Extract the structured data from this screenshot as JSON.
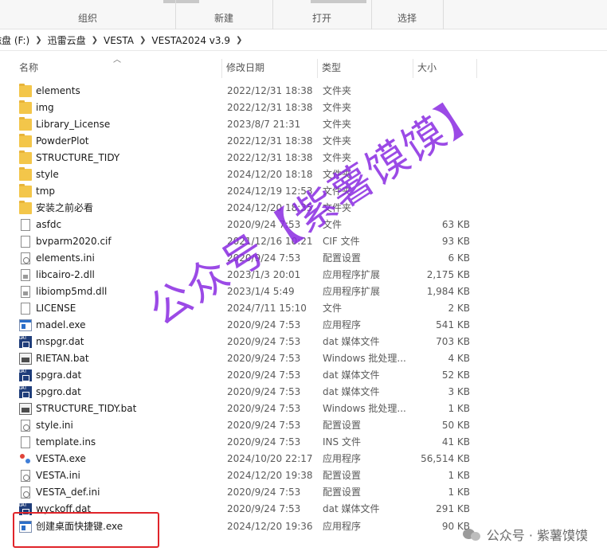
{
  "ribbon": {
    "groups": [
      {
        "label": "组织"
      },
      {
        "label": "新建"
      },
      {
        "label": "打开"
      },
      {
        "label": "选择"
      }
    ]
  },
  "breadcrumb": [
    "磁盘 (F:)",
    "迅雷云盘",
    "VESTA",
    "VESTA2024 v3.9"
  ],
  "columns": {
    "name": "名称",
    "date": "修改日期",
    "type": "类型",
    "size": "大小"
  },
  "files": [
    {
      "name": "elements",
      "date": "2022/12/31 18:38",
      "type": "文件夹",
      "size": "",
      "icon": "folder-icon"
    },
    {
      "name": "img",
      "date": "2022/12/31 18:38",
      "type": "文件夹",
      "size": "",
      "icon": "folder-icon"
    },
    {
      "name": "Library_License",
      "date": "2023/8/7 21:31",
      "type": "文件夹",
      "size": "",
      "icon": "folder-icon"
    },
    {
      "name": "PowderPlot",
      "date": "2022/12/31 18:38",
      "type": "文件夹",
      "size": "",
      "icon": "folder-icon"
    },
    {
      "name": "STRUCTURE_TIDY",
      "date": "2022/12/31 18:38",
      "type": "文件夹",
      "size": "",
      "icon": "folder-icon"
    },
    {
      "name": "style",
      "date": "2024/12/20 18:18",
      "type": "文件夹",
      "size": "",
      "icon": "folder-icon"
    },
    {
      "name": "tmp",
      "date": "2024/12/19 12:53",
      "type": "文件夹",
      "size": "",
      "icon": "folder-icon"
    },
    {
      "name": "安装之前必看",
      "date": "2024/12/20 18:35",
      "type": "文件夹",
      "size": "",
      "icon": "folder-icon"
    },
    {
      "name": "asfdc",
      "date": "2020/9/24 7:53",
      "type": "文件",
      "size": "63 KB",
      "icon": "file-icon"
    },
    {
      "name": "bvparm2020.cif",
      "date": "2021/12/16 10:21",
      "type": "CIF 文件",
      "size": "93 KB",
      "icon": "file-icon"
    },
    {
      "name": "elements.ini",
      "date": "2020/9/24 7:53",
      "type": "配置设置",
      "size": "6 KB",
      "icon": "ini-icon"
    },
    {
      "name": "libcairo-2.dll",
      "date": "2023/1/3 20:01",
      "type": "应用程序扩展",
      "size": "2,175 KB",
      "icon": "dll-icon"
    },
    {
      "name": "libiomp5md.dll",
      "date": "2023/1/4 5:49",
      "type": "应用程序扩展",
      "size": "1,984 KB",
      "icon": "dll-icon"
    },
    {
      "name": "LICENSE",
      "date": "2024/7/11 15:10",
      "type": "文件",
      "size": "2 KB",
      "icon": "file-icon"
    },
    {
      "name": "madel.exe",
      "date": "2020/9/24 7:53",
      "type": "应用程序",
      "size": "541 KB",
      "icon": "exe-icon"
    },
    {
      "name": "mspgr.dat",
      "date": "2020/9/24 7:53",
      "type": "dat 媒体文件",
      "size": "703 KB",
      "icon": "dat-icon"
    },
    {
      "name": "RIETAN.bat",
      "date": "2020/9/24 7:53",
      "type": "Windows 批处理...",
      "size": "4 KB",
      "icon": "bat-icon"
    },
    {
      "name": "spgra.dat",
      "date": "2020/9/24 7:53",
      "type": "dat 媒体文件",
      "size": "52 KB",
      "icon": "dat-icon"
    },
    {
      "name": "spgro.dat",
      "date": "2020/9/24 7:53",
      "type": "dat 媒体文件",
      "size": "3 KB",
      "icon": "dat-icon"
    },
    {
      "name": "STRUCTURE_TIDY.bat",
      "date": "2020/9/24 7:53",
      "type": "Windows 批处理...",
      "size": "1 KB",
      "icon": "bat-icon"
    },
    {
      "name": "style.ini",
      "date": "2020/9/24 7:53",
      "type": "配置设置",
      "size": "50 KB",
      "icon": "ini-icon"
    },
    {
      "name": "template.ins",
      "date": "2020/9/24 7:53",
      "type": "INS 文件",
      "size": "41 KB",
      "icon": "file-icon"
    },
    {
      "name": "VESTA.exe",
      "date": "2024/10/20 22:17",
      "type": "应用程序",
      "size": "56,514 KB",
      "icon": "vesta-icon"
    },
    {
      "name": "VESTA.ini",
      "date": "2024/12/20 19:38",
      "type": "配置设置",
      "size": "1 KB",
      "icon": "ini-icon"
    },
    {
      "name": "VESTA_def.ini",
      "date": "2020/9/24 7:53",
      "type": "配置设置",
      "size": "1 KB",
      "icon": "ini-icon"
    },
    {
      "name": "wyckoff.dat",
      "date": "2020/9/24 7:53",
      "type": "dat 媒体文件",
      "size": "291 KB",
      "icon": "dat-icon"
    },
    {
      "name": "创建桌面快捷键.exe",
      "date": "2024/12/20 19:36",
      "type": "应用程序",
      "size": "90 KB",
      "icon": "exe-icon"
    }
  ],
  "watermark": {
    "text": "公众号【紫薯馍馍】",
    "color": "#8a2be2"
  },
  "brand": {
    "text": "公众号 · 紫薯馍馍"
  },
  "colors": {
    "highlight": "#e0242a",
    "folder": "#f3c64a"
  }
}
